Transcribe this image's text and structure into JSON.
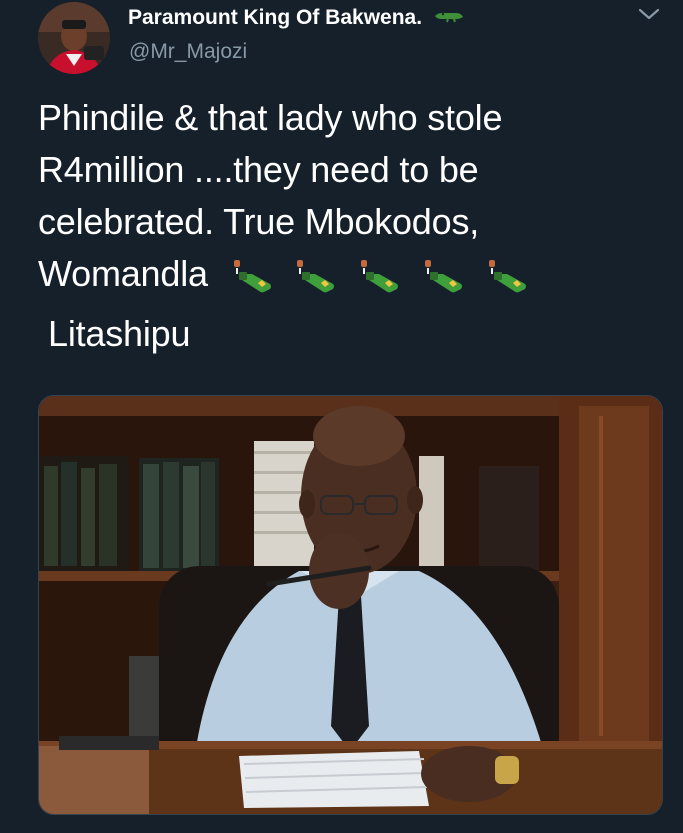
{
  "tweet": {
    "display_name": "Paramount King Of Bakwena.",
    "handle": "@Mr_Majozi",
    "text_lines": [
      "Phindile & that lady who stole",
      "R4million ....they need to be",
      "celebrated. True Mbokodos,",
      "Womandla",
      "Litashipu"
    ],
    "emoji_count": 5,
    "emoji_icon": "bottle-with-popping-cork-icon",
    "name_badge_icon": "crocodile-icon",
    "colors": {
      "background": "#15202b",
      "text": "#ffffff",
      "secondary_text": "#8899a6"
    }
  }
}
